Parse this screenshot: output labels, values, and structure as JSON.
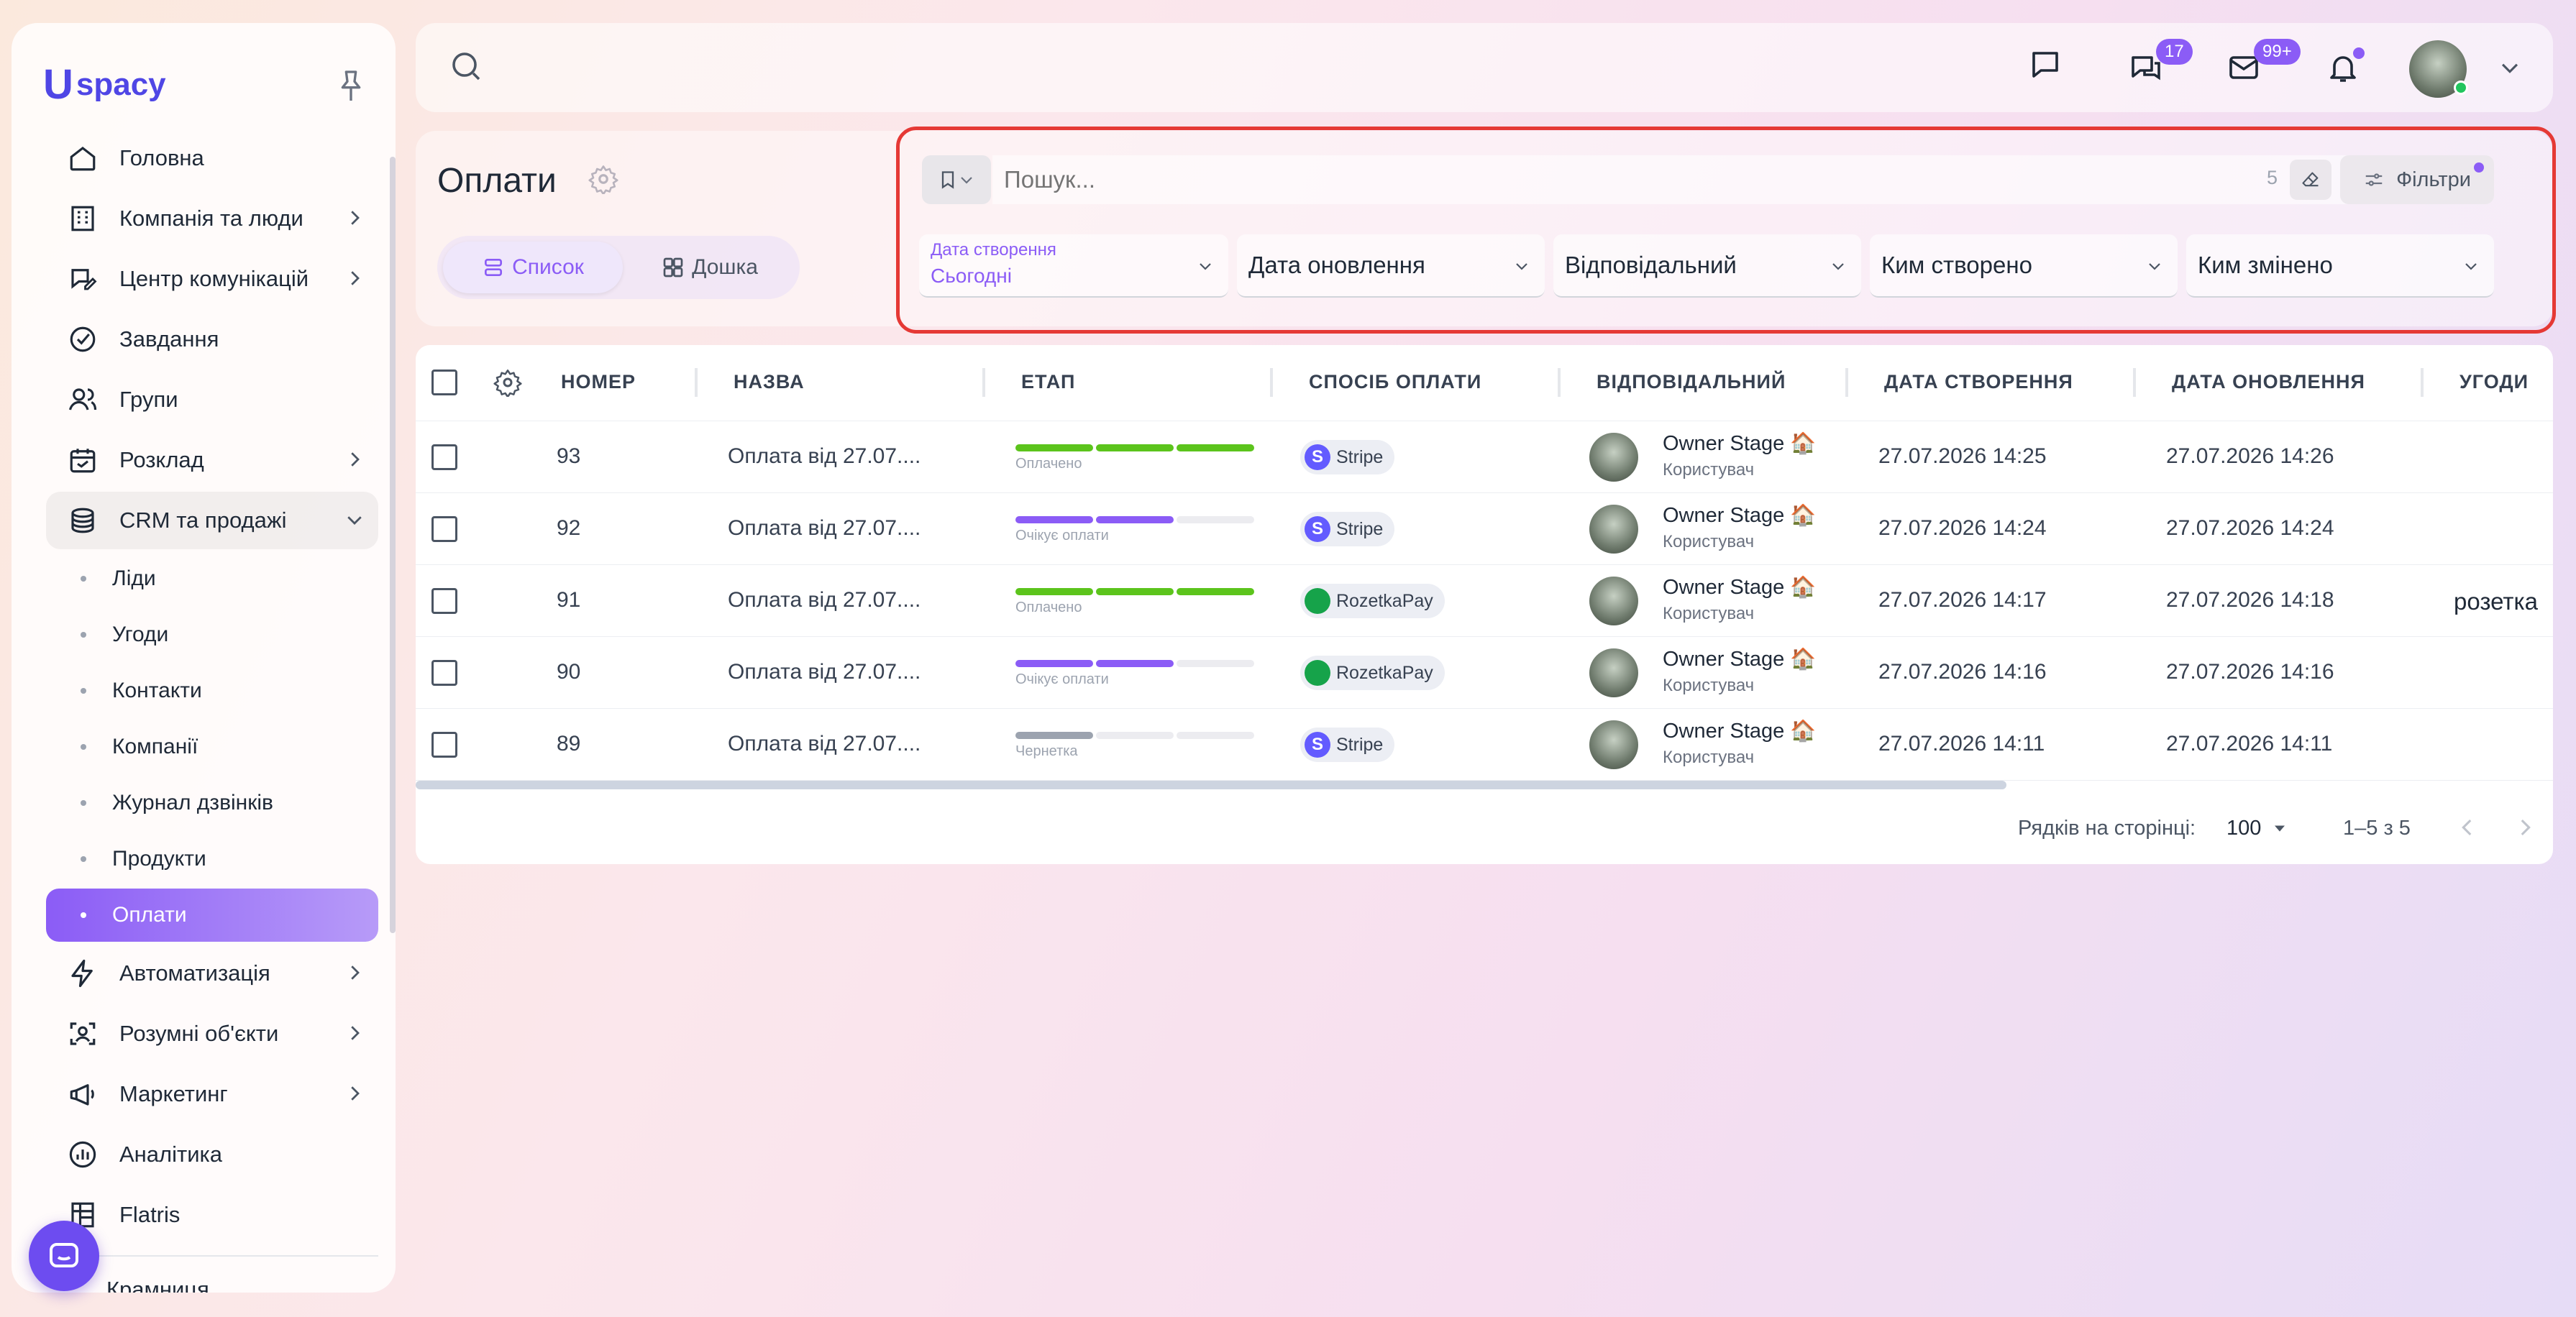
{
  "brand": {
    "logo_mark": "U",
    "logo_text": "spacy"
  },
  "sidebar": {
    "items": [
      {
        "label": "Головна",
        "icon": "home-icon",
        "chevron": false
      },
      {
        "label": "Компанія та люди",
        "icon": "building-icon",
        "chevron": true
      },
      {
        "label": "Центр комунікацій",
        "icon": "chat-edit-icon",
        "chevron": true
      },
      {
        "label": "Завдання",
        "icon": "check-circle-icon",
        "chevron": false
      },
      {
        "label": "Групи",
        "icon": "users-icon",
        "chevron": false
      },
      {
        "label": "Розклад",
        "icon": "calendar-icon",
        "chevron": true
      },
      {
        "label": "CRM та продажі",
        "icon": "coins-icon",
        "chevron": true,
        "open": true
      }
    ],
    "crm_sub": [
      "Ліди",
      "Угоди",
      "Контакти",
      "Компанії",
      "Журнал дзвінків",
      "Продукти",
      "Оплати"
    ],
    "active_sub": "Оплати",
    "items_after": [
      {
        "label": "Автоматизація",
        "icon": "lightning-icon",
        "chevron": true
      },
      {
        "label": "Розумні об'єкти",
        "icon": "scan-icon",
        "chevron": true
      },
      {
        "label": "Маркетинг",
        "icon": "megaphone-icon",
        "chevron": true
      },
      {
        "label": "Аналітика",
        "icon": "chart-icon",
        "chevron": false
      },
      {
        "label": "Flatris",
        "icon": "building-grid-icon",
        "chevron": false
      }
    ],
    "bottom_item": "Крамниця"
  },
  "topbar": {
    "chat_badge": "17",
    "mail_badge": "99+"
  },
  "page": {
    "title": "Оплати",
    "views": {
      "list": "Список",
      "board": "Дошка"
    }
  },
  "filters": {
    "search_placeholder": "Пошук...",
    "count": "5",
    "filters_label": "Фільтри",
    "created_label": "Дата створення",
    "created_value": "Сьогодні",
    "updated": "Дата оновлення",
    "responsible": "Відповідальний",
    "created_by": "Ким створено",
    "changed_by": "Ким змінено"
  },
  "table": {
    "columns": [
      "НОМЕР",
      "НАЗВА",
      "ЕТАП",
      "СПОСІБ ОПЛАТИ",
      "ВІДПОВІДАЛЬНИЙ",
      "ДАТА СТВОРЕННЯ",
      "ДАТА ОНОВЛЕННЯ",
      "УГОДИ"
    ],
    "rows": [
      {
        "number": "93",
        "name": "Оплата від 27.07....",
        "stage": "Оплачено",
        "stage_level": 3,
        "stage_color": "#5cc41c",
        "method": "Stripe",
        "owner": "Owner Stage 🏠",
        "role": "Користувач",
        "created": "27.07.2026 14:25",
        "updated": "27.07.2026 14:26",
        "deals": ""
      },
      {
        "number": "92",
        "name": "Оплата від 27.07....",
        "stage": "Очікує оплати",
        "stage_level": 2,
        "stage_color": "#8b5cf6",
        "method": "Stripe",
        "owner": "Owner Stage 🏠",
        "role": "Користувач",
        "created": "27.07.2026 14:24",
        "updated": "27.07.2026 14:24",
        "deals": ""
      },
      {
        "number": "91",
        "name": "Оплата від 27.07....",
        "stage": "Оплачено",
        "stage_level": 3,
        "stage_color": "#5cc41c",
        "method": "RozetkaPay",
        "owner": "Owner Stage 🏠",
        "role": "Користувач",
        "created": "27.07.2026 14:17",
        "updated": "27.07.2026 14:18",
        "deals": "розетка"
      },
      {
        "number": "90",
        "name": "Оплата від 27.07....",
        "stage": "Очікує оплати",
        "stage_level": 2,
        "stage_color": "#8b5cf6",
        "method": "RozetkaPay",
        "owner": "Owner Stage 🏠",
        "role": "Користувач",
        "created": "27.07.2026 14:16",
        "updated": "27.07.2026 14:16",
        "deals": ""
      },
      {
        "number": "89",
        "name": "Оплата від 27.07....",
        "stage": "Чернетка",
        "stage_level": 1,
        "stage_color": "#9ca3af",
        "method": "Stripe",
        "owner": "Owner Stage 🏠",
        "role": "Користувач",
        "created": "27.07.2026 14:11",
        "updated": "27.07.2026 14:11",
        "deals": ""
      }
    ]
  },
  "pagination": {
    "rows_label": "Рядків на сторінці:",
    "rows_value": "100",
    "range": "1–5 з 5"
  },
  "colors": {
    "accent": "#8b5cf6",
    "brand": "#4f46e5",
    "paid": "#5cc41c",
    "stripe": "#635bff",
    "rozetka": "#16a34a"
  }
}
